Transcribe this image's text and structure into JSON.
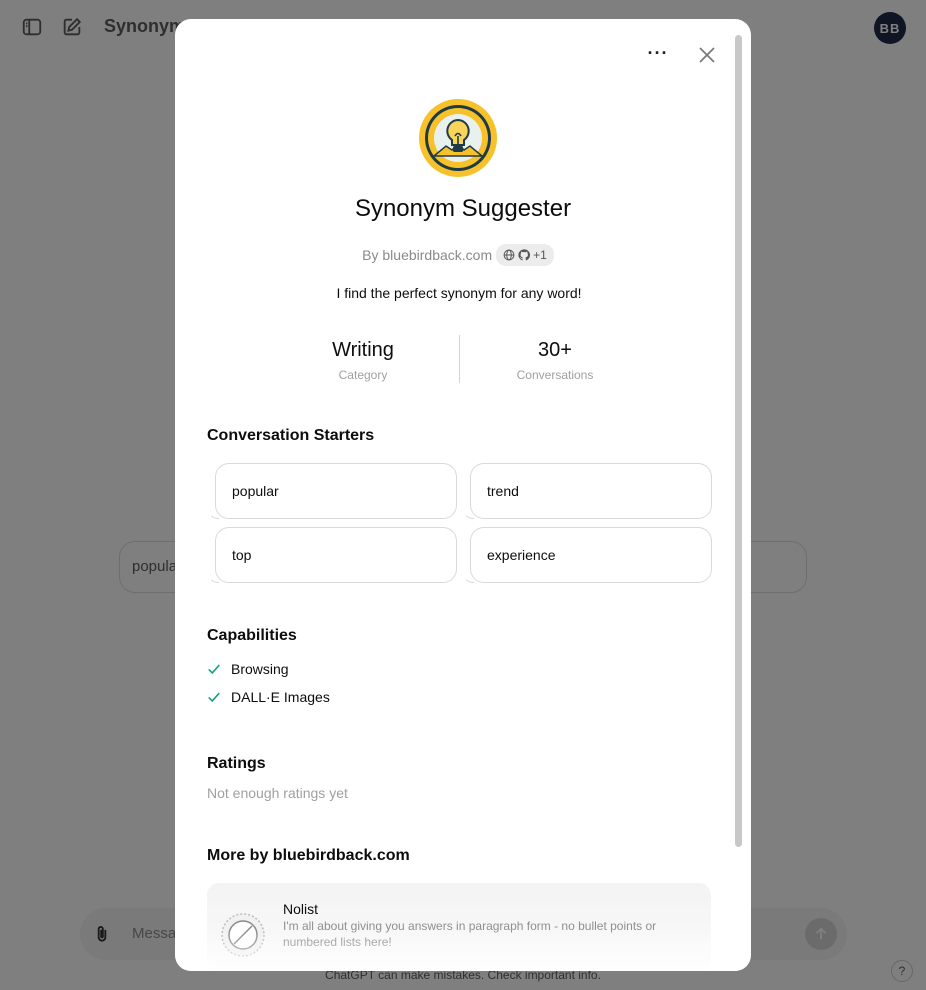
{
  "header": {
    "title": "Synonym",
    "user_initials": "BB",
    "icons": [
      "sidebar-toggle-icon",
      "new-chat-icon"
    ]
  },
  "background": {
    "starter_text": "popula",
    "composer_placeholder": "Message",
    "footer_note": "ChatGPT can make mistakes. Check important info.",
    "help_label": "?"
  },
  "modal": {
    "menu_label": "···",
    "gpt": {
      "name": "Synonym Suggester",
      "by": "By bluebirdback.com",
      "link_count": "+1",
      "description": "I find the perfect synonym for any word!"
    },
    "stats": [
      {
        "value": "Writing",
        "label": "Category"
      },
      {
        "value": "30+",
        "label": "Conversations"
      }
    ],
    "starters_title": "Conversation Starters",
    "starters": [
      "popular",
      "trend",
      "top",
      "experience"
    ],
    "capabilities_title": "Capabilities",
    "capabilities": [
      "Browsing",
      "DALL·E Images"
    ],
    "ratings_title": "Ratings",
    "ratings_note": "Not enough ratings yet",
    "more_title": "More by bluebirdback.com",
    "more_items": [
      {
        "name": "Nolist",
        "description": "I'm all about giving you answers in paragraph form - no bullet points or numbered lists here!"
      }
    ]
  },
  "colors": {
    "overlay": "#808080",
    "accent_check": "#10a37f",
    "avatar_bg": "#1e2a4a",
    "logo_yellow": "#f6c12a"
  }
}
